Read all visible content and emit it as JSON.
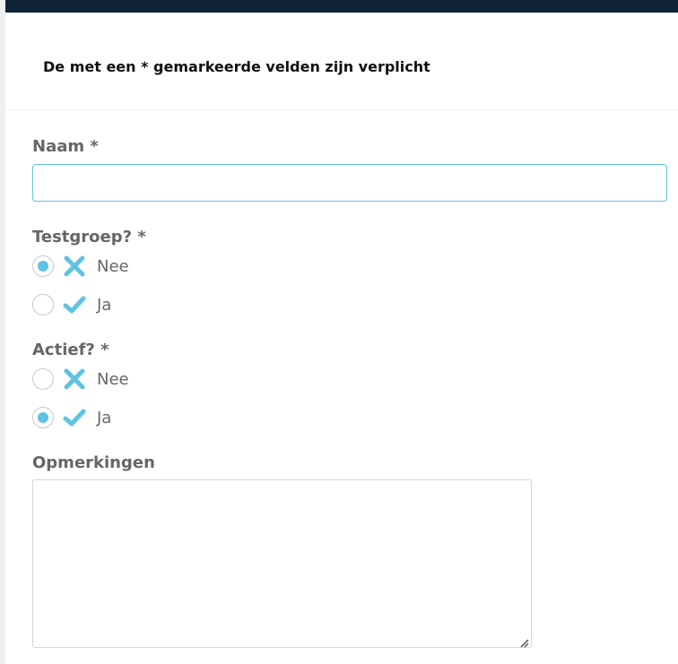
{
  "form": {
    "required_notice": "De met een * gemarkeerde velden zijn verplicht",
    "naam": {
      "label": "Naam *",
      "value": "",
      "placeholder": ""
    },
    "testgroep": {
      "label": "Testgroep? *",
      "selected": "Nee",
      "options": [
        {
          "label": "Nee",
          "icon": "cross-icon"
        },
        {
          "label": "Ja",
          "icon": "checkmark-icon"
        }
      ]
    },
    "actief": {
      "label": "Actief? *",
      "selected": "Ja",
      "options": [
        {
          "label": "Nee",
          "icon": "cross-icon"
        },
        {
          "label": "Ja",
          "icon": "checkmark-icon"
        }
      ]
    },
    "opmerkingen": {
      "label": "Opmerkingen",
      "value": ""
    }
  },
  "colors": {
    "accent": "#5ec3e0",
    "header_bar": "#0f2238",
    "label_text": "#666666"
  }
}
